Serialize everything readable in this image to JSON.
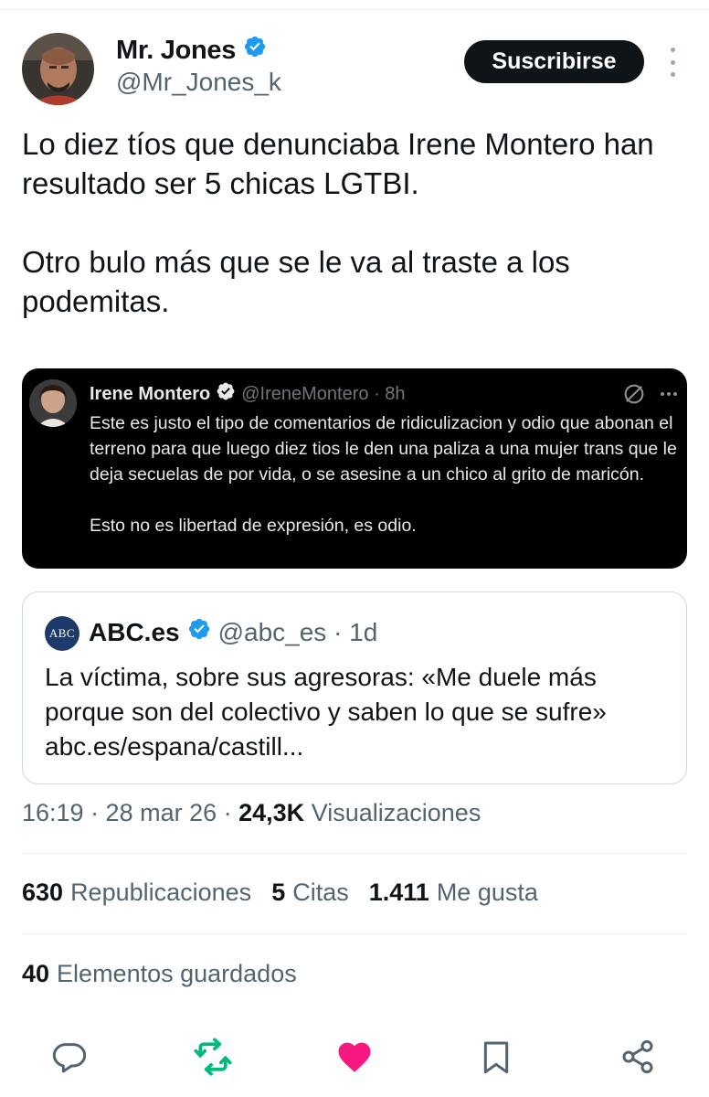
{
  "author": {
    "name": "Mr. Jones",
    "handle": "@Mr_Jones_k",
    "subscribe_label": "Suscribirse"
  },
  "tweet": {
    "paragraph1": "Lo diez tíos que denunciaba Irene Montero han resultado ser 5 chicas LGTBI.",
    "paragraph2": "Otro bulo más que se le va al traste a los podemitas."
  },
  "embedded_screenshot": {
    "name": "Irene Montero",
    "handle_time": "@IreneMontero · 8h",
    "paragraph1": "Este es justo el tipo de comentarios de ridiculizacion y odio que abonan el terreno para que luego diez tios le den una paliza a una mujer trans que le deja secuelas de por vida, o se asesine a un chico al grito de maricón.",
    "paragraph2": "Esto no es libertad de expresión, es odio."
  },
  "quoted_tweet": {
    "logo_text": "ABC",
    "name": "ABC.es",
    "handle_time": "@abc_es · 1d",
    "text": "La víctima, sobre sus agresoras: «Me duele más porque son del colectivo y saben lo que se sufre» abc.es/espana/castill..."
  },
  "meta": {
    "time_date": "16:19 · 28 mar 26 · ",
    "views_count": "24,3K",
    "views_label": "Visualizaciones"
  },
  "stats": {
    "reposts_count": "630",
    "reposts_label": "Republicaciones",
    "quotes_count": "5",
    "quotes_label": "Citas",
    "likes_count": "1.411",
    "likes_label": "Me gusta",
    "bookmarks_count": "40",
    "bookmarks_label": "Elementos guardados"
  },
  "colors": {
    "verified": "#1d9bf0",
    "repost_active": "#00ba7c",
    "like_active": "#f91880",
    "text_secondary": "#536471"
  }
}
